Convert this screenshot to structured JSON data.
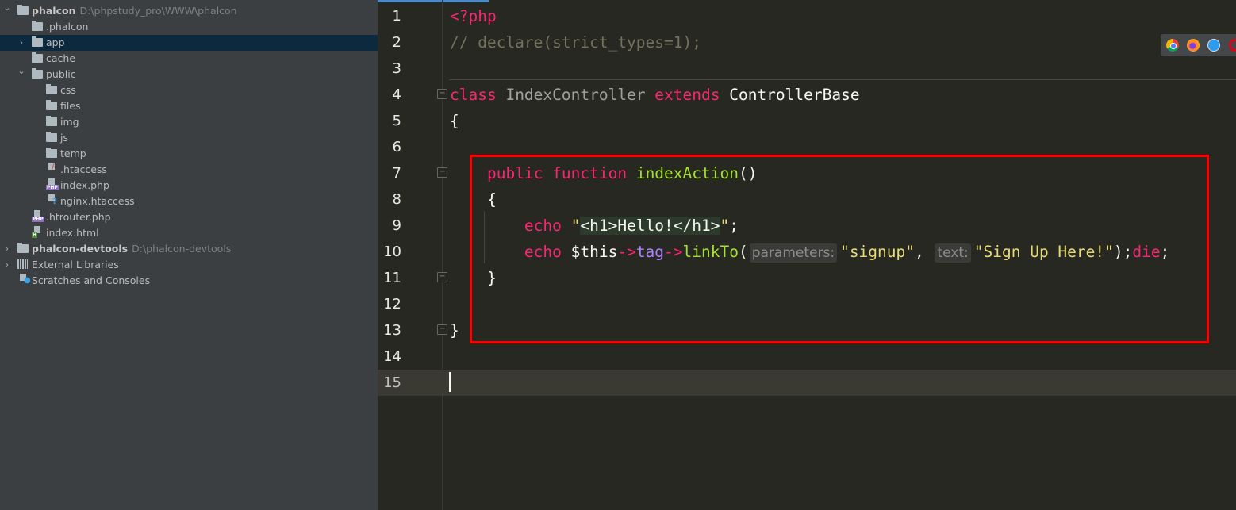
{
  "project_tree": [
    {
      "label": "phalcon",
      "path": "D:\\phpstudy_pro\\WWW\\phalcon",
      "icon": "folder-icon",
      "depth": 0,
      "expanded": true,
      "bold": true
    },
    {
      "label": ".phalcon",
      "icon": "folder-icon",
      "depth": 1
    },
    {
      "label": "app",
      "icon": "folder-icon",
      "depth": 1,
      "expanded": false,
      "selected": true
    },
    {
      "label": "cache",
      "icon": "folder-icon",
      "depth": 1
    },
    {
      "label": "public",
      "icon": "folder-icon",
      "depth": 1,
      "expanded": true
    },
    {
      "label": "css",
      "icon": "folder-icon",
      "depth": 2
    },
    {
      "label": "files",
      "icon": "folder-icon",
      "depth": 2
    },
    {
      "label": "img",
      "icon": "folder-icon",
      "depth": 2
    },
    {
      "label": "js",
      "icon": "folder-icon",
      "depth": 2
    },
    {
      "label": "temp",
      "icon": "folder-icon",
      "depth": 2
    },
    {
      "label": ".htaccess",
      "icon": "apache-file-icon",
      "depth": 2
    },
    {
      "label": "index.php",
      "icon": "php-file-icon",
      "depth": 2
    },
    {
      "label": "nginx.htaccess",
      "icon": "unknown-file-icon",
      "depth": 2
    },
    {
      "label": ".htrouter.php",
      "icon": "php-file-icon",
      "depth": 1
    },
    {
      "label": "index.html",
      "icon": "html-file-icon",
      "depth": 1
    },
    {
      "label": "phalcon-devtools",
      "path": "D:\\phalcon-devtools",
      "icon": "folder-icon",
      "depth": 0,
      "expanded": false,
      "bold": true
    },
    {
      "label": "External Libraries",
      "icon": "libraries-icon",
      "depth": 0,
      "expanded": false
    },
    {
      "label": "Scratches and Consoles",
      "icon": "scratches-icon",
      "depth": 0
    }
  ],
  "editor": {
    "current_line": 15,
    "lines": [
      {
        "n": "1",
        "tokens": [
          [
            "<?php",
            "kw"
          ]
        ]
      },
      {
        "n": "2",
        "tokens": [
          [
            "// declare(strict_types=1);",
            "cm"
          ]
        ]
      },
      {
        "n": "3",
        "tokens": []
      },
      {
        "n": "4",
        "tokens": [
          [
            "class ",
            "kw"
          ],
          [
            "IndexController ",
            "cls"
          ],
          [
            "extends ",
            "kw"
          ],
          [
            "ControllerBase",
            "pl"
          ]
        ]
      },
      {
        "n": "5",
        "tokens": [
          [
            "{",
            "pl"
          ]
        ]
      },
      {
        "n": "6",
        "tokens": []
      },
      {
        "n": "7",
        "tokens": [
          [
            "    ",
            "pl"
          ],
          [
            "public ",
            "kw"
          ],
          [
            "function ",
            "kw"
          ],
          [
            "indexAction",
            "fn"
          ],
          [
            "()",
            "pl"
          ]
        ]
      },
      {
        "n": "8",
        "tokens": [
          [
            "    {",
            "pl"
          ]
        ]
      },
      {
        "n": "9",
        "tokens": [
          [
            "        ",
            "pl"
          ],
          [
            "echo ",
            "kw"
          ],
          [
            "\"",
            "str"
          ],
          [
            "<",
            "hl"
          ],
          [
            "h1",
            "hl kw"
          ],
          [
            ">Hello!</",
            "hl"
          ],
          [
            "h1",
            "hl kw"
          ],
          [
            ">",
            "hl"
          ],
          [
            "\"",
            "str"
          ],
          [
            ";",
            "pl"
          ]
        ]
      },
      {
        "n": "10",
        "tokens": [
          [
            "        ",
            "pl"
          ],
          [
            "echo ",
            "kw"
          ],
          [
            "$this",
            "pl"
          ],
          [
            "->",
            "kw"
          ],
          [
            "tag",
            "pr"
          ],
          [
            "->",
            "kw"
          ],
          [
            "linkTo",
            "fn"
          ],
          [
            "(",
            "pl"
          ],
          [
            "parameters:",
            "hint"
          ],
          [
            "\"signup\"",
            "str"
          ],
          [
            ", ",
            "pl"
          ],
          [
            "text:",
            "hint"
          ],
          [
            "\"Sign Up Here!\"",
            "str"
          ],
          [
            ");",
            "pl"
          ],
          [
            "die",
            "kw"
          ],
          [
            ";",
            "pl"
          ]
        ]
      },
      {
        "n": "11",
        "tokens": [
          [
            "    }",
            "pl"
          ]
        ]
      },
      {
        "n": "12",
        "tokens": []
      },
      {
        "n": "13",
        "tokens": [
          [
            "}",
            "pl"
          ]
        ]
      },
      {
        "n": "14",
        "tokens": []
      },
      {
        "n": "15",
        "tokens": []
      }
    ]
  },
  "annotation_box_color": "#ff0000",
  "browser_icons": [
    "chrome-icon",
    "firefox-icon",
    "safari-icon",
    "opera-icon"
  ]
}
